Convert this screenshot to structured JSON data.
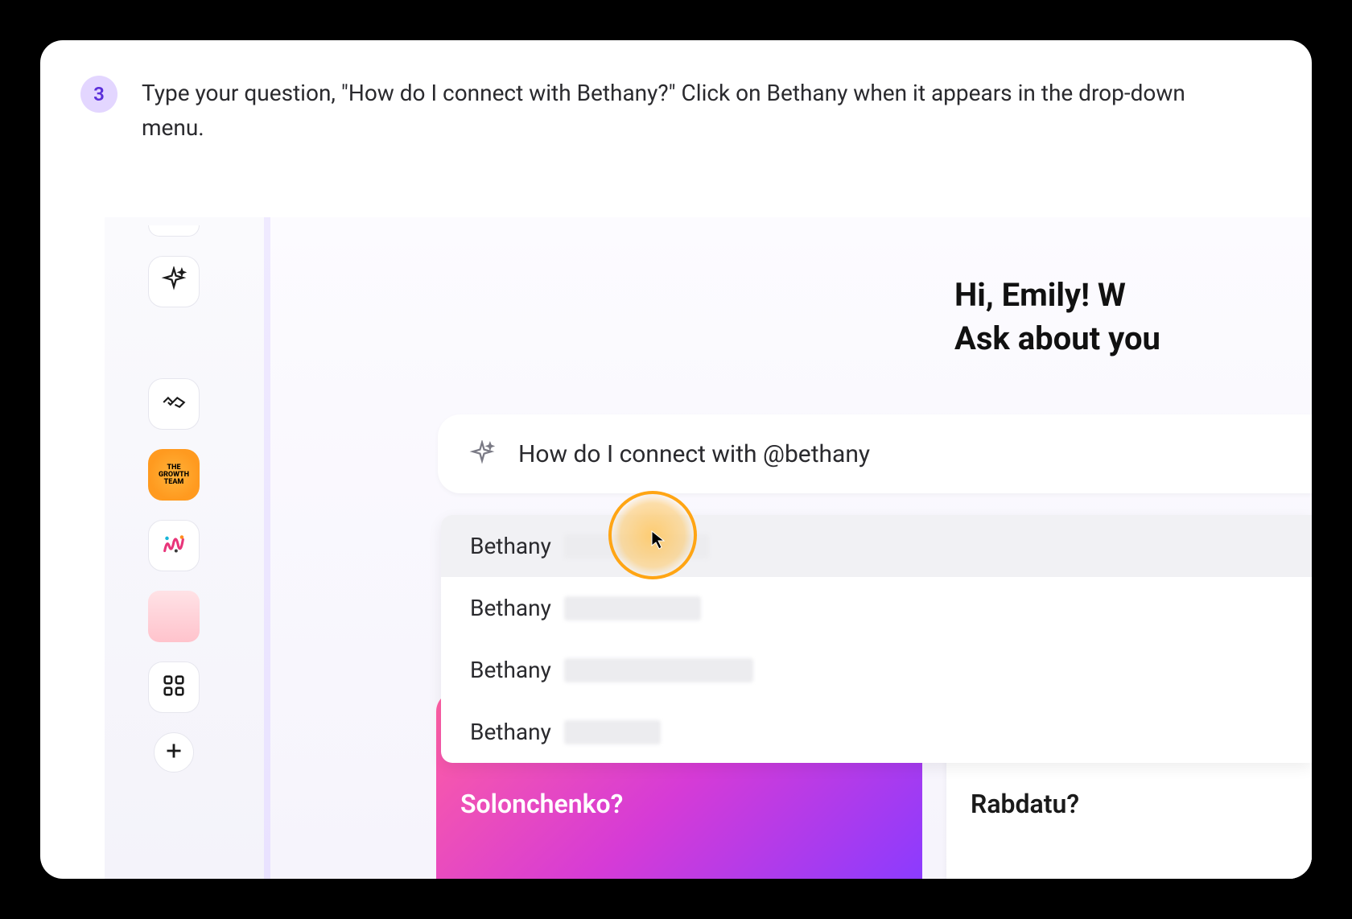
{
  "step": {
    "number": "3",
    "text": "Type your question, \"How do I connect with Bethany?\" Click on Bethany when it appears in the drop-down menu."
  },
  "greeting": {
    "line1": "Hi, Emily! W",
    "line2": "Ask about you"
  },
  "search": {
    "value": "How do I connect with @bethany"
  },
  "dropdown": {
    "items": [
      {
        "name": "Bethany",
        "hover": true,
        "blurWidth": 180
      },
      {
        "name": "Bethany",
        "hover": false,
        "blurWidth": 170
      },
      {
        "name": "Bethany",
        "hover": false,
        "blurWidth": 235
      },
      {
        "name": "Bethany",
        "hover": false,
        "blurWidth": 120
      }
    ]
  },
  "suggestions": {
    "left": "Solonchenko?",
    "right": "Rabdatu?"
  },
  "colors": {
    "badgeBg": "#e3d6ff",
    "badgeFg": "#5b2fd9",
    "highlight": "#ffa514"
  }
}
